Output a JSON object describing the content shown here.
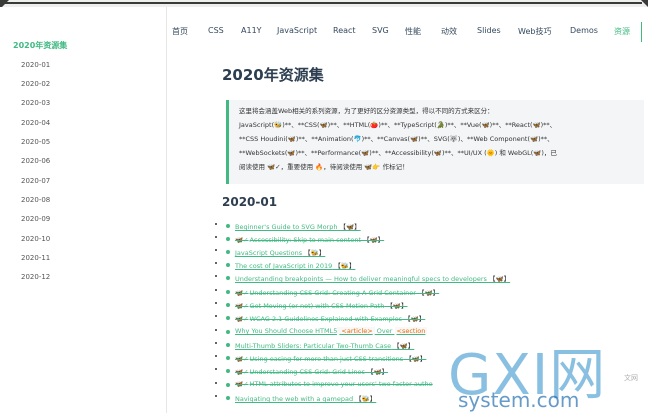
{
  "sidebar": {
    "heading": "2020年资源集",
    "items": [
      "2020-01",
      "2020-02",
      "2020-03",
      "2020-04",
      "2020-05",
      "2020-06",
      "2020-07",
      "2020-08",
      "2020-09",
      "2020-10",
      "2020-11",
      "2020-12"
    ]
  },
  "nav": {
    "items": [
      "首页",
      "CSS",
      "A11Y",
      "JavaScript",
      "React",
      "SVG",
      "性能",
      "动效",
      "Slides",
      "Web技巧",
      "Demos",
      "资源"
    ]
  },
  "main": {
    "title": "2020年资源集",
    "quote": {
      "line1": "这里将会涵盖Web相关的系列资源，为了更好的区分资源类型，得以不同的方式来区分：",
      "line2": "JavaScript(🐝)**、**CSS(🦋)**、**HTML(🍅)**、**TypeScript(🐊)**、**Vue(🦋)**、**React(🦋)**、",
      "line3": "**CSS Houdini(🦋)**、**Animation(🐬)**、**Canvas(🦋)**、SVG(🐺)、**Web Component(🦋)**、",
      "line4": "**WebSockets(🦋)**、**Performance(🦋)**、**Accessibility(🦋)**、**UI/UX (🌞) 和 WebGL(🦋)，已",
      "line5": "阅读使用 🦋✓，重要使用 🔥，待阅读使用 🦋👉 作标记！"
    },
    "section_title": "2020-01",
    "list": [
      {
        "text": "Beginner's Guide to SVG Morph",
        "tag": "【🦋】",
        "done": false,
        "check": ""
      },
      {
        "text": "Accessibility: Skip to main content",
        "tag": "【🦋】",
        "done": true,
        "check": "🦋✓"
      },
      {
        "text": "JavaScript Questions",
        "tag": "【🐝】",
        "done": false,
        "check": ""
      },
      {
        "text": "The cost of JavaScript in 2019",
        "tag": "【🐝】",
        "done": false,
        "check": ""
      },
      {
        "text": "Understanding breakpoints — How to deliver meaningful specs to developers",
        "tag": "【🦋】",
        "done": false,
        "check": ""
      },
      {
        "text": "Understanding CSS Grid: Creating A Grid Container",
        "tag": "【🦋】",
        "done": true,
        "check": "🦋✓"
      },
      {
        "text": "Get Moving (or not) with CSS Motion Path",
        "tag": "【🦋】",
        "done": true,
        "check": "🦋✓"
      },
      {
        "text": "WCAG 2.1 Guidelines Explained with Examples",
        "tag": "【🦋】",
        "done": true,
        "check": "🦋✓"
      },
      {
        "text": "Why You Should Choose HTML5",
        "code1": "<article>",
        "mid": " Over ",
        "code2": "<section",
        "done": false,
        "check": ""
      },
      {
        "text": "Multi-Thumb Sliders: Particular Two-Thumb Case",
        "tag": "【🦋】",
        "done": false,
        "check": ""
      },
      {
        "text": "Using easing for more than just CSS transitions",
        "tag": "【🦋】",
        "done": true,
        "check": "🦋✓"
      },
      {
        "text": "Understanding CSS Grid: Grid Lines",
        "tag": "【🦋】",
        "done": true,
        "check": "🦋✓"
      },
      {
        "text": "HTML attributes to improve your users' two factor authe",
        "tag": "",
        "done": true,
        "check": "🦋✓"
      },
      {
        "text": "Navigating the web with a gamepad",
        "tag": "【🐝】",
        "done": false,
        "check": ""
      }
    ]
  },
  "watermark": {
    "big": "GXI网",
    "small": "system.com",
    "tiny": "文网"
  },
  "colors": {
    "accent": "#42b983",
    "text": "#2c3e50",
    "quote_bg": "#f3f5f7"
  }
}
